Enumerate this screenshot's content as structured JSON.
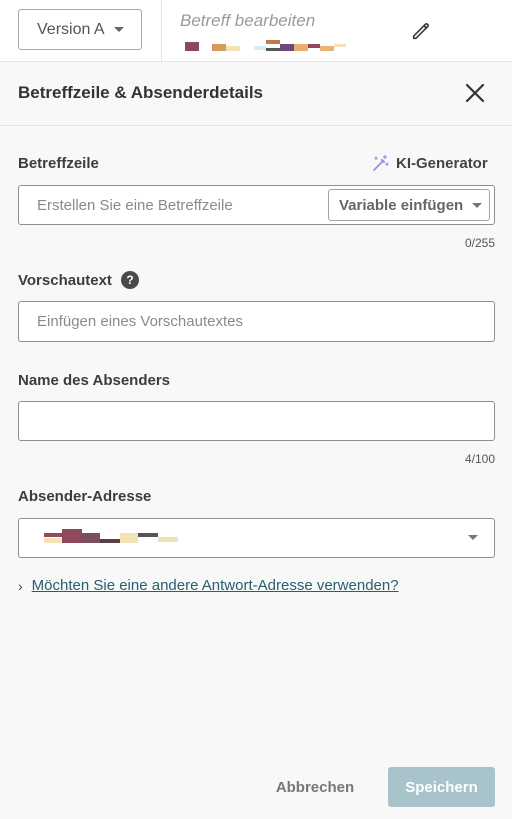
{
  "topbar": {
    "version_label": "Version A",
    "subject_edit_label": "Betreff bearbeiten"
  },
  "panel": {
    "title": "Betreffzeile & Absenderdetails"
  },
  "subject": {
    "label": "Betreffzeile",
    "ki_generator_label": "KI-Generator",
    "placeholder": "Erstellen Sie eine Betreffzeile",
    "variable_button_label": "Variable einfügen",
    "counter": "0/255"
  },
  "preview": {
    "label": "Vorschautext",
    "help_glyph": "?",
    "placeholder": "Einfügen eines Vorschautextes"
  },
  "sender_name": {
    "label": "Name des Absenders",
    "value": "",
    "counter": "4/100"
  },
  "sender_address": {
    "label": "Absender-Adresse"
  },
  "reply_link": {
    "chevron": "›",
    "text": "Möchten Sie eine andere Antwort-Adresse verwenden?"
  },
  "footer": {
    "cancel_label": "Abbrechen",
    "save_label": "Speichern"
  },
  "colors": {
    "accent_link": "#26606e",
    "save_button_disabled": "#a9c3cb"
  }
}
